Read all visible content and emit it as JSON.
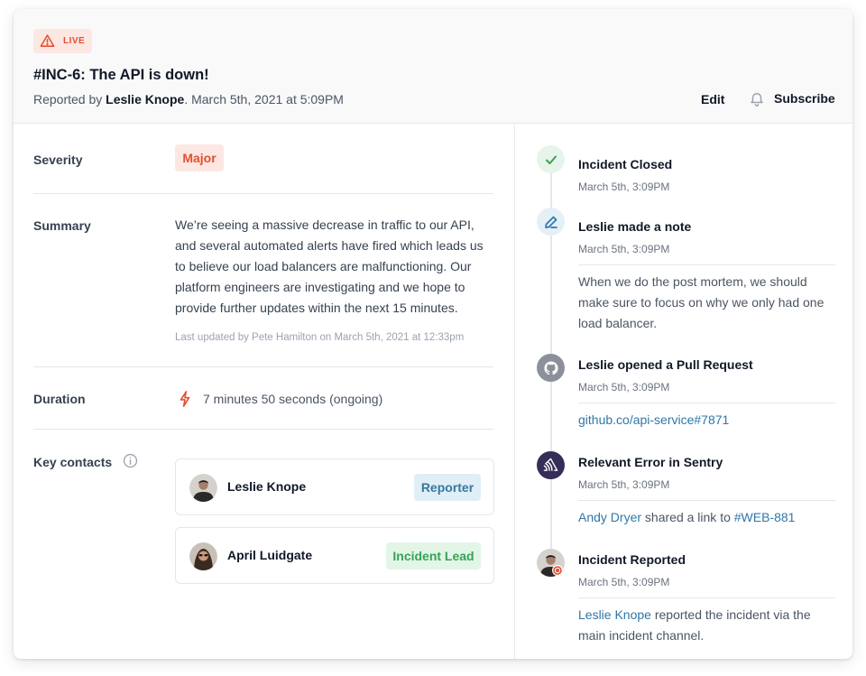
{
  "header": {
    "live_label": "LIVE",
    "title": "#INC-6: The API is down!",
    "reported_prefix": "Reported by",
    "reporter": "Leslie Knope",
    "reported_suffix": ". March 5th, 2021 at 5:09PM",
    "edit_label": "Edit",
    "subscribe_label": "Subscribe",
    "icons": [
      "warning-triangle-icon",
      "bell-icon"
    ]
  },
  "details": {
    "severity_label": "Severity",
    "severity_value": "Major",
    "summary_label": "Summary",
    "summary_text": "We’re seeing a massive decrease in traffic to our API, and several automated alerts have fired which leads us to believe our load balancers are malfunctioning. Our platform engineers are investigating and we hope to provide further updates within the next 15 minutes.",
    "last_updated": "Last updated by Pete Hamilton on March 5th, 2021 at 12:33pm",
    "duration_label": "Duration",
    "duration_value": "7 minutes 50 seconds (ongoing)",
    "contacts_label": "Key contacts",
    "contacts": [
      {
        "name": "Leslie Knope",
        "role": "Reporter"
      },
      {
        "name": "April Luidgate",
        "role": "Incident Lead"
      }
    ]
  },
  "timeline": [
    {
      "icon": "check-icon",
      "title": "Incident Closed",
      "time": "March 5th, 3:09PM"
    },
    {
      "icon": "pencil-icon",
      "title": "Leslie made a note",
      "time": "March 5th, 3:09PM",
      "body": "When we do the post mortem, we should make sure to focus on why we only had one load balancer."
    },
    {
      "icon": "github-icon",
      "title": "Leslie opened a Pull Request",
      "time": "March 5th, 3:09PM",
      "link": "github.co/api-service#7871"
    },
    {
      "icon": "sentry-icon",
      "title": "Relevant Error in Sentry",
      "time": "March 5th, 3:09PM",
      "user": "Andy Dryer",
      "mid": " shared a link to ",
      "link": "#WEB-881"
    },
    {
      "icon": "avatar-alert-icon",
      "title": "Incident Reported",
      "time": "March 5th, 3:09PM",
      "user": "Leslie Knope",
      "body": " reported the incident via the main incident channel."
    }
  ],
  "colors": {
    "accent_red": "#e1502f",
    "link_blue": "#2f77a8",
    "success_green": "#37a354",
    "sentry_purple": "#362d59"
  }
}
